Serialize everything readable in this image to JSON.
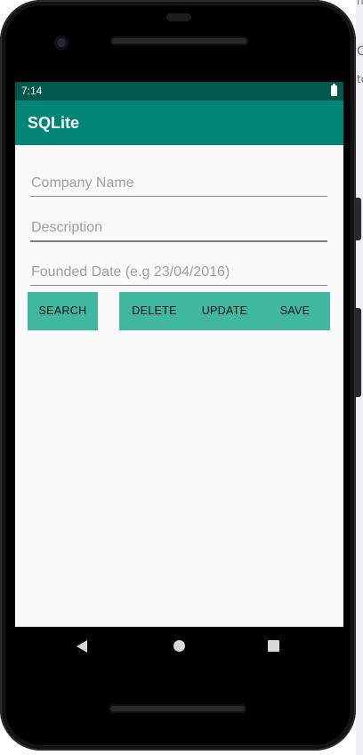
{
  "status_bar": {
    "time": "7:14",
    "background": "#00574b"
  },
  "app_bar": {
    "title": "SQLite",
    "background": "#008577"
  },
  "form": {
    "company_name": {
      "value": "",
      "placeholder": "Company Name"
    },
    "description": {
      "value": "",
      "placeholder": "Description"
    },
    "founded_date": {
      "value": "",
      "placeholder": "Founded Date (e.g 23/04/2016)"
    }
  },
  "buttons": {
    "search": "SEARCH",
    "delete": "DELETE",
    "update": "UPDATE",
    "save": "SAVE",
    "color": "#40b8a0"
  },
  "navigation": {
    "back_icon": "back-triangle",
    "home_icon": "home-circle",
    "recents_icon": "recents-square"
  },
  "desktop_edge": {
    "frag1": "nc",
    "frag2": "C",
    "frag3": "to"
  }
}
